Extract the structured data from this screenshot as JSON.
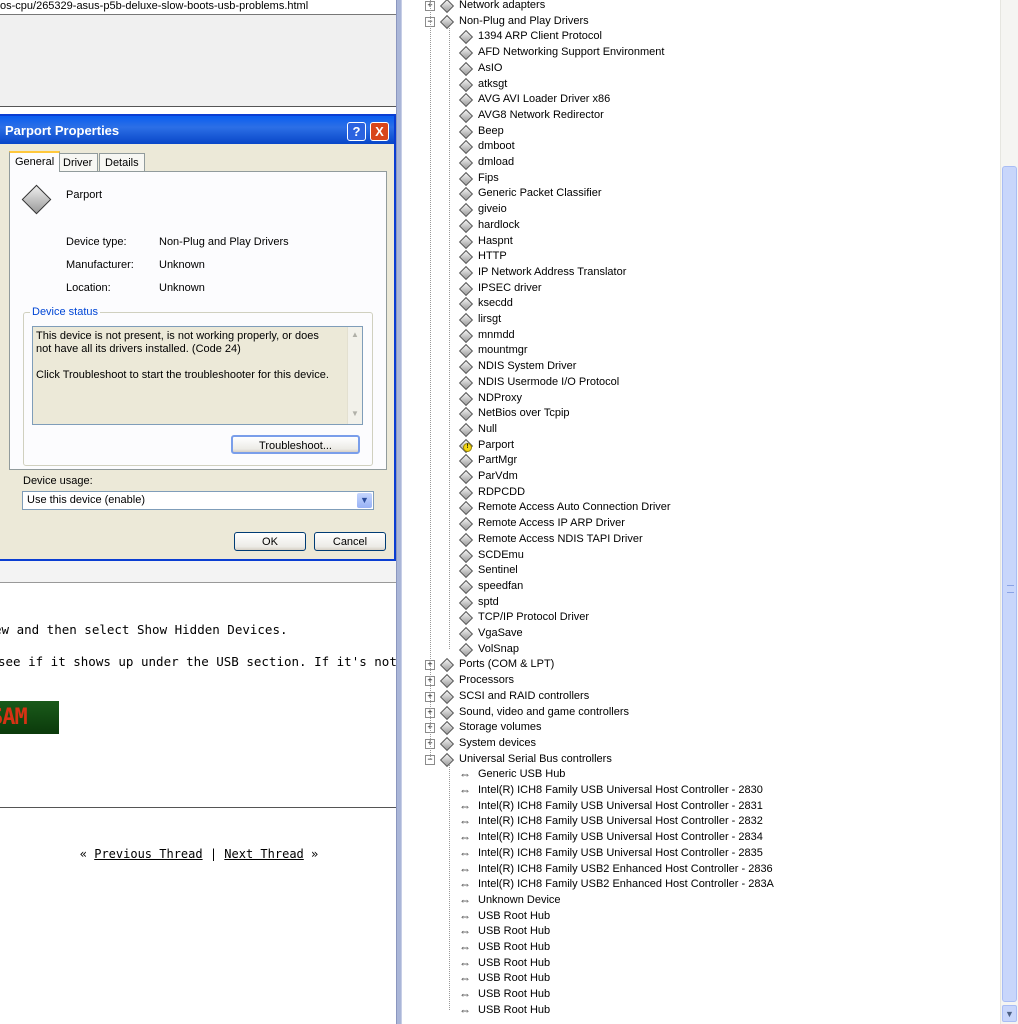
{
  "browser": {
    "url_fragment": "os-cpu/265329-asus-p5b-deluxe-slow-boots-usb-problems.html",
    "post_line1": "ew and then select Show Hidden Devices.",
    "post_line2": " see if it shows up under the USB section. If it's not there, lo",
    "signature_text": "SAM",
    "nav_prev_marker": "«",
    "nav_prev": "Previous Thread",
    "nav_sep": "|",
    "nav_next": "Next Thread",
    "nav_next_marker": "»"
  },
  "dialog": {
    "title": "Parport Properties",
    "help_glyph": "?",
    "close_glyph": "X",
    "tabs": [
      "General",
      "Driver",
      "Details"
    ],
    "device_name": "Parport",
    "properties": [
      {
        "label": "Device type:",
        "value": "Non-Plug and Play Drivers"
      },
      {
        "label": "Manufacturer:",
        "value": "Unknown"
      },
      {
        "label": "Location:",
        "value": "Unknown"
      }
    ],
    "status_legend": "Device status",
    "status_text_1": "This device is not present, is not working properly, or does not have all its drivers installed. (Code 24)",
    "status_text_2": "Click Troubleshoot to start the troubleshooter for this device.",
    "troubleshoot_label": "Troubleshoot...",
    "usage_label": "Device usage:",
    "usage_value": "Use this device (enable)",
    "ok_label": "OK",
    "cancel_label": "Cancel"
  },
  "tree": {
    "top_categories": [
      {
        "label": "Network adapters",
        "expander": "+",
        "icon": "network-icon"
      },
      {
        "label": "Non-Plug and Play Drivers",
        "expander": "−",
        "icon": "device-icon"
      }
    ],
    "nonpnp_items": [
      "1394 ARP Client Protocol",
      "AFD Networking Support Environment",
      "AsIO",
      "atksgt",
      "AVG AVI Loader Driver x86",
      "AVG8 Network Redirector",
      "Beep",
      "dmboot",
      "dmload",
      "Fips",
      "Generic Packet Classifier",
      "giveio",
      "hardlock",
      "Haspnt",
      "HTTP",
      "IP Network Address Translator",
      "IPSEC driver",
      "ksecdd",
      "lirsgt",
      "mnmdd",
      "mountmgr",
      "NDIS System Driver",
      "NDIS Usermode I/O Protocol",
      "NDProxy",
      "NetBios over Tcpip",
      "Null",
      "Parport",
      "PartMgr",
      "ParVdm",
      "RDPCDD",
      "Remote Access Auto Connection Driver",
      "Remote Access IP ARP Driver",
      "Remote Access NDIS TAPI Driver",
      "SCDEmu",
      "Sentinel",
      "speedfan",
      "sptd",
      "TCP/IP Protocol Driver",
      "VgaSave",
      "VolSnap"
    ],
    "warning_item": "Parport",
    "mid_categories": [
      {
        "label": "Ports (COM & LPT)",
        "expander": "+",
        "icon": "port-icon"
      },
      {
        "label": "Processors",
        "expander": "+",
        "icon": "processor-icon"
      },
      {
        "label": "SCSI and RAID controllers",
        "expander": "+",
        "icon": "scsi-icon"
      },
      {
        "label": "Sound, video and game controllers",
        "expander": "+",
        "icon": "sound-icon"
      },
      {
        "label": "Storage volumes",
        "expander": "+",
        "icon": "storage-icon"
      },
      {
        "label": "System devices",
        "expander": "+",
        "icon": "system-icon"
      },
      {
        "label": "Universal Serial Bus controllers",
        "expander": "−",
        "icon": "usb-icon"
      }
    ],
    "usb_items": [
      "Generic USB Hub",
      "Intel(R) ICH8 Family USB Universal Host Controller - 2830",
      "Intel(R) ICH8 Family USB Universal Host Controller - 2831",
      "Intel(R) ICH8 Family USB Universal Host Controller - 2832",
      "Intel(R) ICH8 Family USB Universal Host Controller - 2834",
      "Intel(R) ICH8 Family USB Universal Host Controller - 2835",
      "Intel(R) ICH8 Family USB2 Enhanced Host Controller - 2836",
      "Intel(R) ICH8 Family USB2 Enhanced Host Controller - 283A",
      "Unknown Device",
      "USB Root Hub",
      "USB Root Hub",
      "USB Root Hub",
      "USB Root Hub",
      "USB Root Hub",
      "USB Root Hub",
      "USB Root Hub"
    ],
    "usb_glyph": "⇔",
    "warn_glyph": "!"
  },
  "scrollbar": {
    "down_arrow": "▼"
  }
}
